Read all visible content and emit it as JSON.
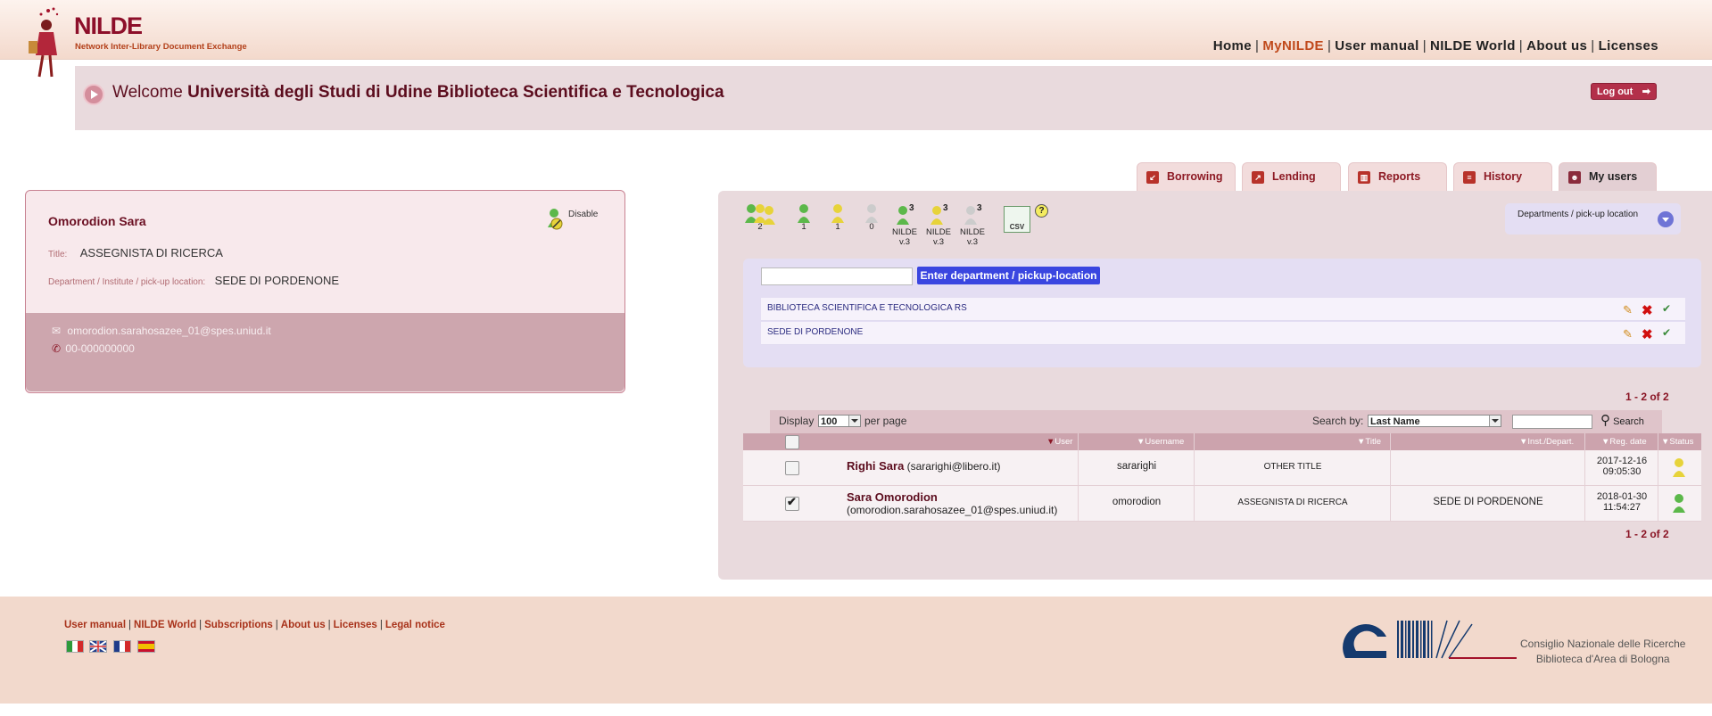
{
  "header": {
    "logo": "NILDE",
    "logo_subtitle": "Network Inter-Library Document Exchange",
    "nav": [
      "Home",
      "MyNILDE",
      "User manual",
      "NILDE World",
      "About us",
      "Licenses"
    ],
    "welcome_prefix": "Welcome",
    "welcome_name": "Università degli Studi di Udine Biblioteca Scientifica e Tecnologica",
    "logout": "Log out"
  },
  "tabs": [
    "Borrowing",
    "Lending",
    "Reports",
    "History",
    "My users"
  ],
  "user_card": {
    "name": "Omorodion Sara",
    "disable": "Disable",
    "title_label": "Title:",
    "title_value": "ASSEGNISTA DI RICERCA",
    "dept_label": "Department / Institute / pick-up location:",
    "dept_value": "SEDE DI PORDENONE",
    "email": "omorodion.sarahosazee_01@spes.uniud.it",
    "phone": "00-000000000"
  },
  "filters": {
    "all_count": "2",
    "green_count": "1",
    "yellow_count": "1",
    "grey_count": "0",
    "nilde_badge": "3",
    "nilde_label": "NILDE",
    "nilde_version": "v.3",
    "csv": "CSV",
    "help": "?"
  },
  "departments": {
    "toggle_label": "Departments / pick-up location",
    "input_value": "",
    "add_button": "Enter department / pickup-location",
    "rows": [
      "BIBLIOTECA SCIENTIFICA E TECNOLOGICA RS",
      "SEDE DI PORDENONE"
    ]
  },
  "table": {
    "pager": "1 - 2 of 2",
    "display_label": "Display",
    "per_page_value": "100",
    "per_page_label": "per page",
    "search_by_label": "Search by:",
    "search_by_value": "Last Name",
    "search_value": "",
    "search_button": "Search",
    "headers": [
      "User",
      "Username",
      "Title",
      "Inst./Depart.",
      "Reg. date",
      "Status"
    ],
    "rows": [
      {
        "name": "Righi Sara",
        "email": "(sararighi@libero.it)",
        "username": "sararighi",
        "title": "OTHER TITLE",
        "dept": "",
        "date": "2017-12-16",
        "time": "09:05:30",
        "status": "yellow",
        "checked": false
      },
      {
        "name": "Sara Omorodion",
        "email": "(omorodion.sarahosazee_01@spes.uniud.it)",
        "username": "omorodion",
        "title": "ASSEGNISTA DI RICERCA",
        "dept": "SEDE DI PORDENONE",
        "date": "2018-01-30",
        "time": "11:54:27",
        "status": "green",
        "checked": true
      }
    ]
  },
  "footer": {
    "links": [
      "User manual",
      "NILDE World",
      "Subscriptions",
      "About us",
      "Licenses",
      "Legal notice"
    ],
    "cnr_line1": "Consiglio Nazionale delle Ricerche",
    "cnr_line2": "Biblioteca d'Area di Bologna"
  }
}
